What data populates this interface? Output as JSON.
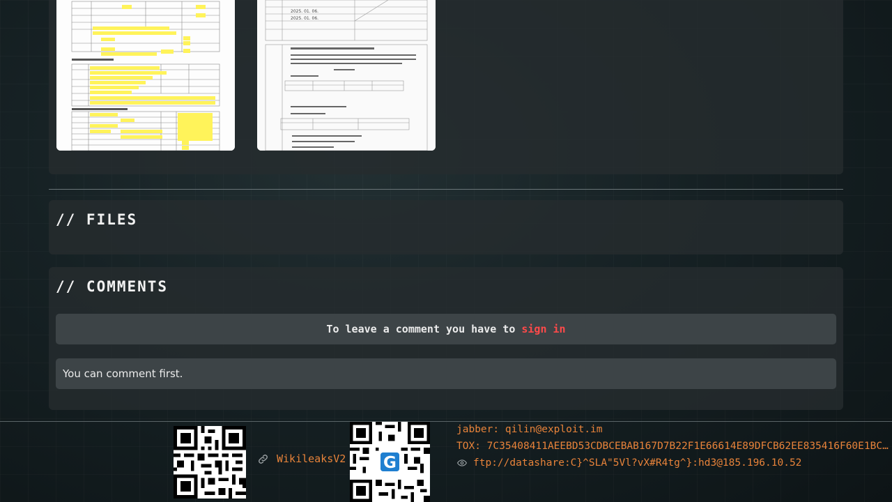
{
  "gallery": {
    "images": [
      {
        "alt": "document-scan-1"
      },
      {
        "alt": "document-scan-2"
      }
    ],
    "doc2": {
      "date1": "2025. 01. 06.",
      "date2": "2025. 01. 06."
    }
  },
  "files": {
    "title": "// FILES"
  },
  "comments": {
    "title": "// COMMENTS",
    "signin_prefix": "To leave a comment you have to",
    "signin_link": "sign in",
    "empty_message": "You can comment first."
  },
  "footer": {
    "wikileaks_label": "WikileaksV2",
    "jabber": "jabber: qilin@exploit.im",
    "tox": "TOX: 7C35408411AEEBD53CDBCEBAB167D7B22F1E66614E89DFCB62EE835416F60E1BC…",
    "ftp": "ftp://datashare:C}^SLA\"5Vl?vX#R4tg^}:hd3@185.196.10.52"
  },
  "colors": {
    "accent": "#e8833a",
    "link_red": "#ff4a4a",
    "panel": "#262c2e",
    "box": "#3d4447"
  },
  "icons": {
    "link": "link-icon",
    "eye": "eye-icon"
  }
}
